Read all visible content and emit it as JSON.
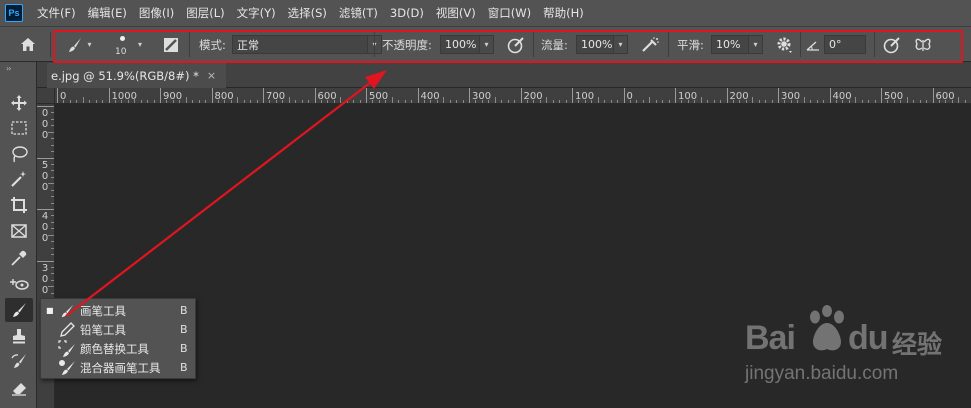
{
  "app": {
    "logo_text": "Ps"
  },
  "menu": [
    "文件(F)",
    "编辑(E)",
    "图像(I)",
    "图层(L)",
    "文字(Y)",
    "选择(S)",
    "滤镜(T)",
    "3D(D)",
    "视图(V)",
    "窗口(W)",
    "帮助(H)"
  ],
  "options": {
    "brush_size": "10",
    "mode_label": "模式:",
    "mode_value": "正常",
    "opacity_label": "不透明度:",
    "opacity_value": "100%",
    "flow_label": "流量:",
    "flow_value": "100%",
    "smooth_label": "平滑:",
    "smooth_value": "10%",
    "angle_value": "0°"
  },
  "document": {
    "tab_title": "e.jpg @ 51.9%(RGB/8#) *",
    "close_glyph": "×"
  },
  "ruler": {
    "h_ticks": [
      "0",
      "1000",
      "900",
      "800",
      "700",
      "600",
      "500",
      "400",
      "300",
      "200",
      "100",
      "0",
      "100",
      "200",
      "300",
      "400",
      "500",
      "600"
    ],
    "v_ticks": [
      "0\n0\n0",
      "5\n0\n0",
      "4\n0\n0",
      "3\n0\n0"
    ]
  },
  "flyout": {
    "items": [
      {
        "label": "画笔工具",
        "key": "B",
        "icon": "brush-icon",
        "selected": true
      },
      {
        "label": "铅笔工具",
        "key": "B",
        "icon": "pencil-icon",
        "selected": false
      },
      {
        "label": "颜色替换工具",
        "key": "B",
        "icon": "color-replacement-icon",
        "selected": false
      },
      {
        "label": "混合器画笔工具",
        "key": "B",
        "icon": "mixer-brush-icon",
        "selected": false
      }
    ]
  },
  "tools": [
    "move-tool",
    "marquee-tool",
    "lasso-tool",
    "magic-wand-tool",
    "crop-tool",
    "frame-tool",
    "eyedropper-tool",
    "healing-tool",
    "brush-tool",
    "stamp-tool",
    "history-brush-tool",
    "eraser-tool"
  ],
  "watermark": {
    "brand_left": "Bai",
    "brand_right": "du",
    "brand_cn": "经验",
    "url": "jingyan.baidu.com"
  },
  "colors": {
    "annotation": "#e0151f",
    "panel": "#535353",
    "canvas": "#282828"
  }
}
